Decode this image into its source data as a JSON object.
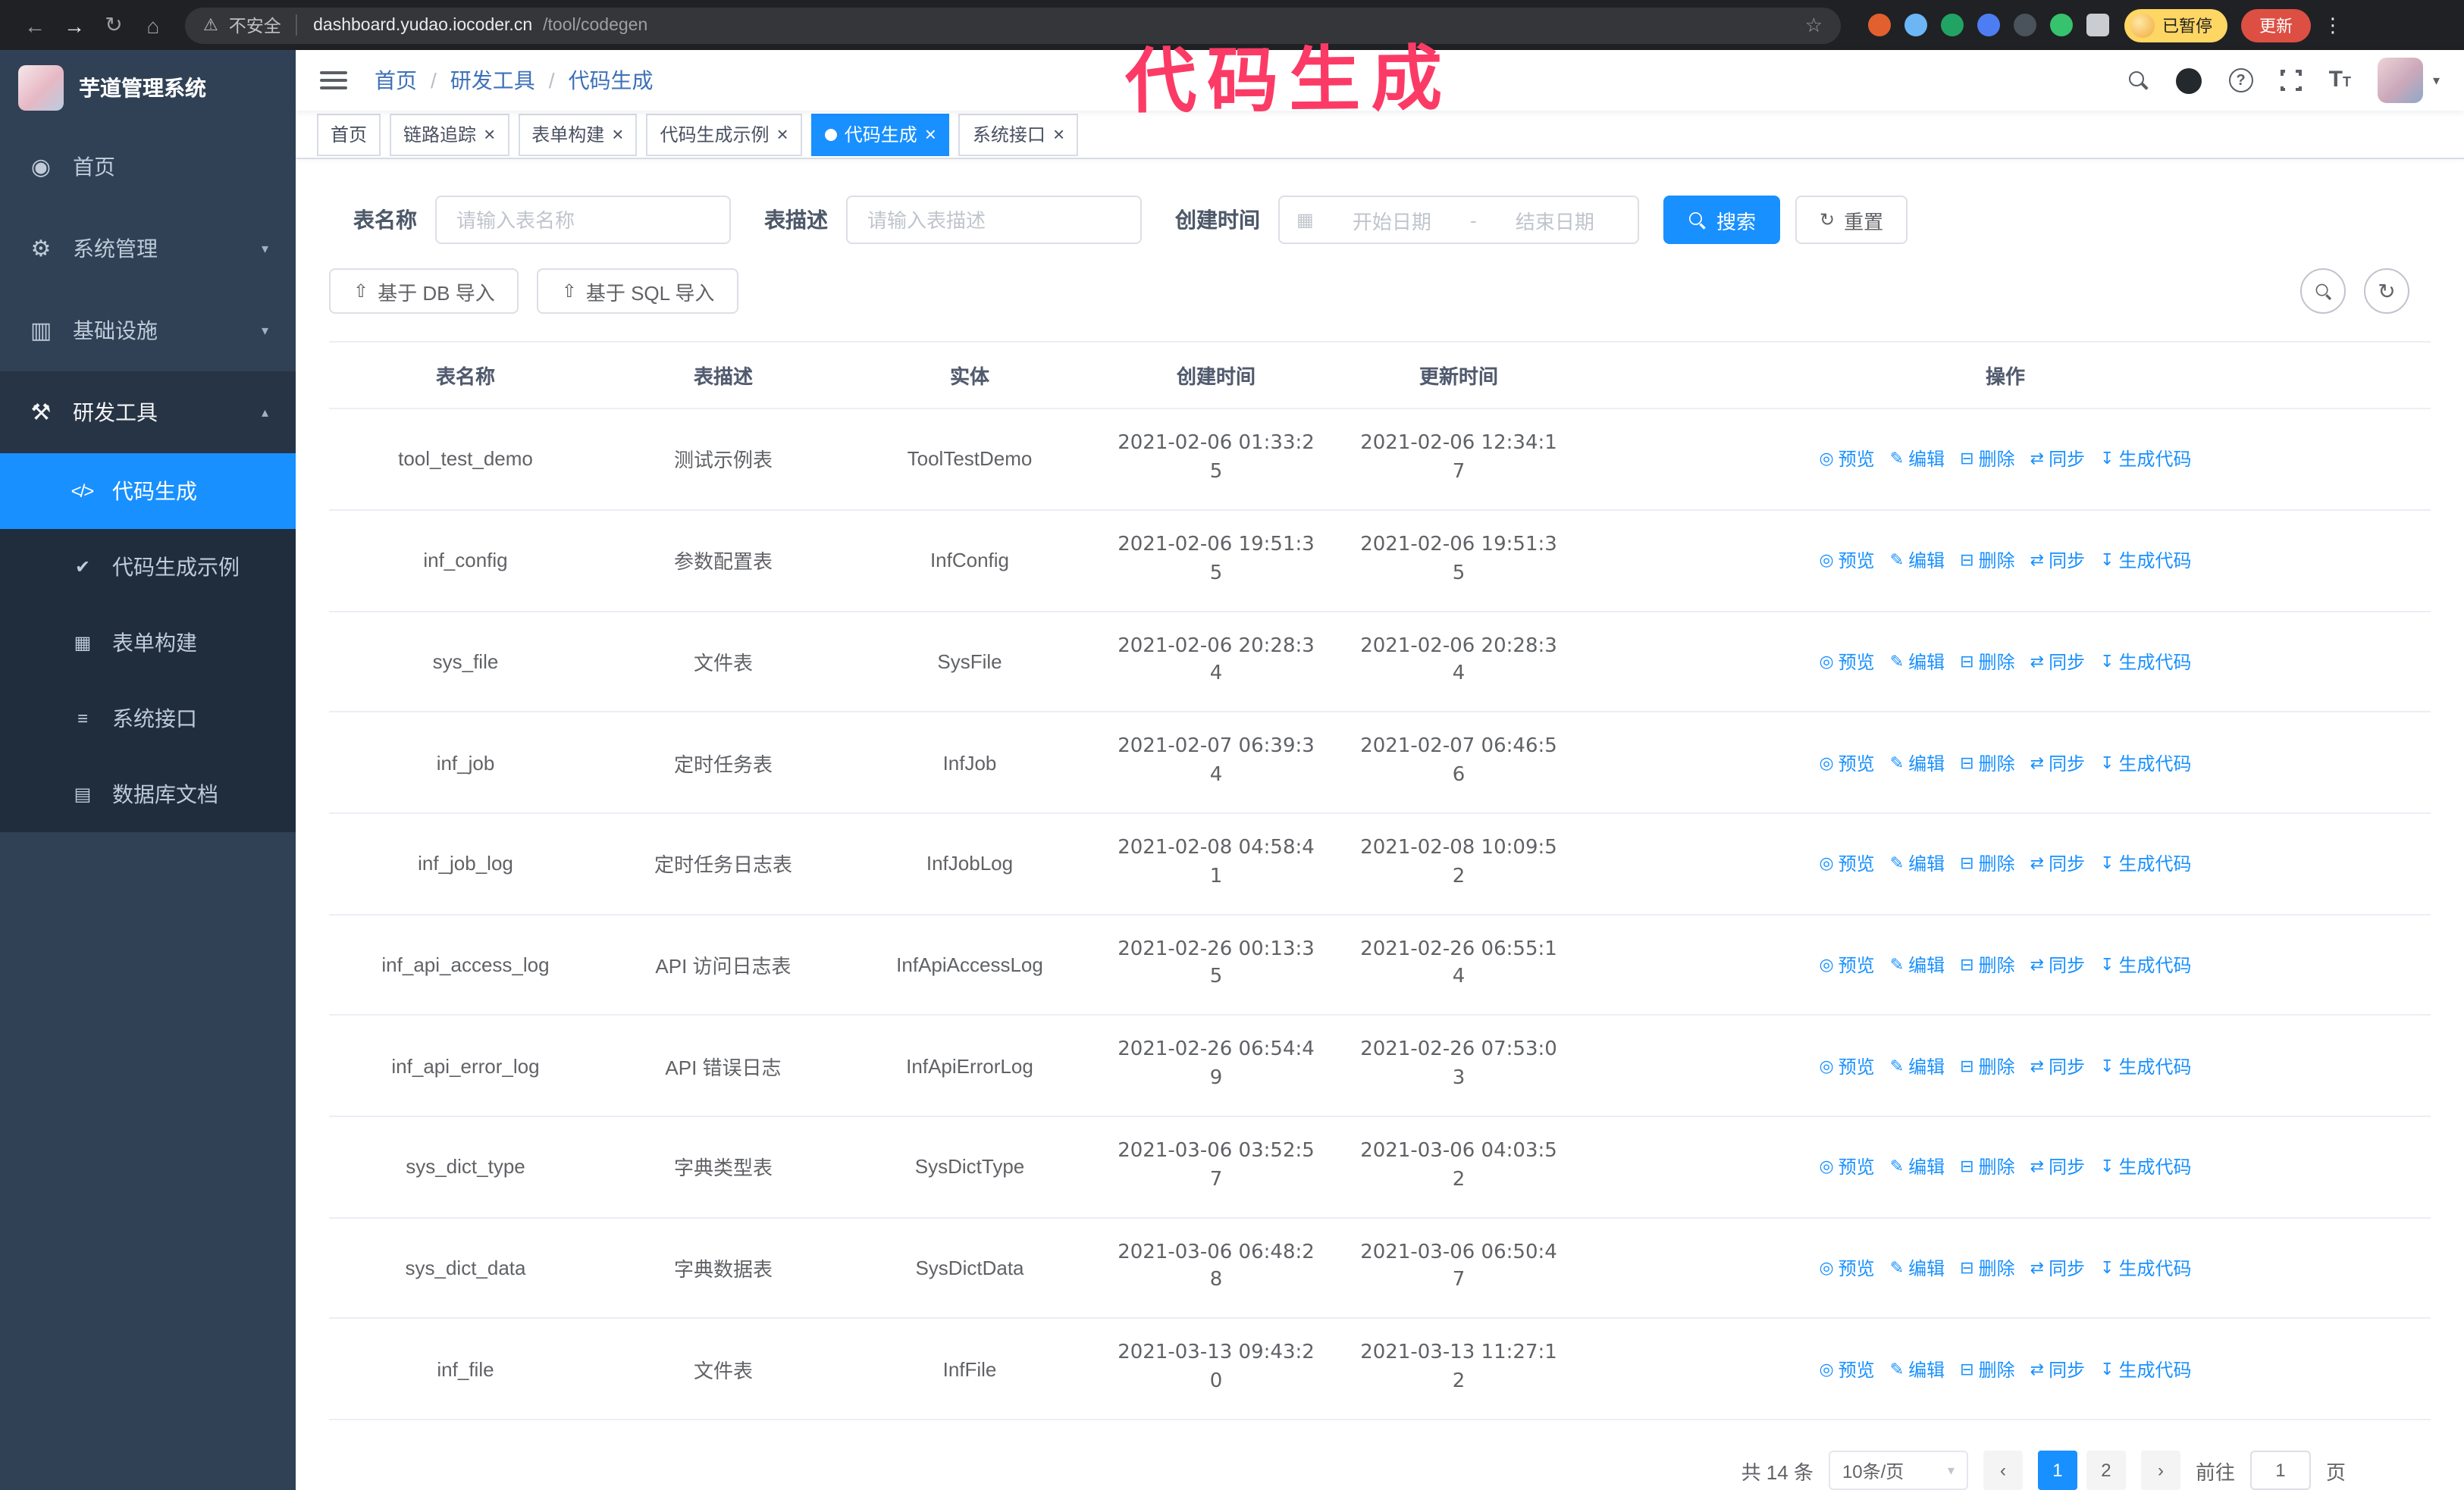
{
  "browser": {
    "security_label": "不安全",
    "url_domain": "dashboard.yudao.iocoder.cn",
    "url_path": "/tool/codegen",
    "profile_badge": "已暂停",
    "update_button": "更新",
    "extensions": [
      {
        "name": "extension-icon-orange",
        "color": "#e2602f"
      },
      {
        "name": "extension-icon-lightblue",
        "color": "#6cb6f5"
      },
      {
        "name": "extension-icon-green",
        "color": "#21a463"
      },
      {
        "name": "extension-icon-blue",
        "color": "#4d7df2"
      },
      {
        "name": "extension-icon-gray",
        "color": "#4a525c"
      },
      {
        "name": "extension-icon-brightgreen",
        "color": "#37c26e"
      },
      {
        "name": "puzzle-extensions-icon",
        "color": "#c9cdd2",
        "shape": "square"
      }
    ]
  },
  "annotation": "代码生成",
  "icons": {
    "back": "←",
    "forward": "→",
    "reload": "↻",
    "home": "⌂",
    "warning": "⚠",
    "pipe": "│",
    "star": "☆",
    "kebab": "⋮",
    "caret-down": "▾",
    "caret-up": "▴",
    "close": "×",
    "question": "?",
    "font-big": "T",
    "font-small": "T",
    "calendar": "▦",
    "refresh": "↻",
    "upload": "⇧",
    "prev": "‹",
    "next": "›",
    "dashboard": "◉",
    "gear": "⚙",
    "infra": "▥",
    "tools": "⚒",
    "code": "</>",
    "example": "✔",
    "form": "▦",
    "api": "≡",
    "dbdoc": "▤",
    "eye": "◎",
    "edit": "✎",
    "trash": "⊟",
    "sync": "⇄",
    "download": "↧"
  },
  "sidebar": {
    "logo_title": "芋道管理系统",
    "items": [
      {
        "label": "首页",
        "icon": "dashboard",
        "icon_name": "dashboard-icon"
      },
      {
        "label": "系统管理",
        "icon": "gear",
        "icon_name": "gear-icon",
        "arrow": "down"
      },
      {
        "label": "基础设施",
        "icon": "infra",
        "icon_name": "infrastructure-icon",
        "arrow": "down"
      },
      {
        "label": "研发工具",
        "icon": "tools",
        "icon_name": "tools-icon",
        "arrow": "up",
        "expanded": true,
        "children": [
          {
            "label": "代码生成",
            "icon": "code",
            "icon_name": "code-icon",
            "active": true
          },
          {
            "label": "代码生成示例",
            "icon": "example",
            "icon_name": "code-example-icon"
          },
          {
            "label": "表单构建",
            "icon": "form",
            "icon_name": "form-builder-icon"
          },
          {
            "label": "系统接口",
            "icon": "api",
            "icon_name": "api-icon"
          },
          {
            "label": "数据库文档",
            "icon": "dbdoc",
            "icon_name": "database-doc-icon"
          }
        ]
      }
    ]
  },
  "breadcrumb": [
    "首页",
    "研发工具",
    "代码生成"
  ],
  "tabs": [
    {
      "label": "首页",
      "closable": false,
      "active": false
    },
    {
      "label": "链路追踪",
      "closable": true,
      "active": false
    },
    {
      "label": "表单构建",
      "closable": true,
      "active": false
    },
    {
      "label": "代码生成示例",
      "closable": true,
      "active": false
    },
    {
      "label": "代码生成",
      "closable": true,
      "active": true
    },
    {
      "label": "系统接口",
      "closable": true,
      "active": false
    }
  ],
  "filters": {
    "table_name_label": "表名称",
    "table_name_placeholder": "请输入表名称",
    "table_desc_label": "表描述",
    "table_desc_placeholder": "请输入表描述",
    "create_time_label": "创建时间",
    "start_placeholder": "开始日期",
    "range_separator": "-",
    "end_placeholder": "结束日期",
    "search_label": "搜索",
    "reset_label": "重置"
  },
  "toolbar": {
    "import_db_label": "基于 DB 导入",
    "import_sql_label": "基于 SQL 导入"
  },
  "table": {
    "columns": [
      "表名称",
      "表描述",
      "实体",
      "创建时间",
      "更新时间",
      "操作"
    ],
    "actions": [
      {
        "label": "预览",
        "icon": "eye",
        "name": "preview-link"
      },
      {
        "label": "编辑",
        "icon": "edit",
        "name": "edit-link"
      },
      {
        "label": "删除",
        "icon": "trash",
        "name": "delete-link"
      },
      {
        "label": "同步",
        "icon": "sync",
        "name": "sync-link"
      },
      {
        "label": "生成代码",
        "icon": "download",
        "name": "generate-code-link"
      }
    ],
    "rows": [
      {
        "name": "tool_test_demo",
        "desc": "测试示例表",
        "entity": "ToolTestDemo",
        "created": "2021-02-06 01:33:25",
        "updated": "2021-02-06 12:34:17"
      },
      {
        "name": "inf_config",
        "desc": "参数配置表",
        "entity": "InfConfig",
        "created": "2021-02-06 19:51:35",
        "updated": "2021-02-06 19:51:35"
      },
      {
        "name": "sys_file",
        "desc": "文件表",
        "entity": "SysFile",
        "created": "2021-02-06 20:28:34",
        "updated": "2021-02-06 20:28:34"
      },
      {
        "name": "inf_job",
        "desc": "定时任务表",
        "entity": "InfJob",
        "created": "2021-02-07 06:39:34",
        "updated": "2021-02-07 06:46:56"
      },
      {
        "name": "inf_job_log",
        "desc": "定时任务日志表",
        "entity": "InfJobLog",
        "created": "2021-02-08 04:58:41",
        "updated": "2021-02-08 10:09:52"
      },
      {
        "name": "inf_api_access_log",
        "desc": "API 访问日志表",
        "entity": "InfApiAccessLog",
        "created": "2021-02-26 00:13:35",
        "updated": "2021-02-26 06:55:14"
      },
      {
        "name": "inf_api_error_log",
        "desc": "API 错误日志",
        "entity": "InfApiErrorLog",
        "created": "2021-02-26 06:54:49",
        "updated": "2021-02-26 07:53:03"
      },
      {
        "name": "sys_dict_type",
        "desc": "字典类型表",
        "entity": "SysDictType",
        "created": "2021-03-06 03:52:57",
        "updated": "2021-03-06 04:03:52"
      },
      {
        "name": "sys_dict_data",
        "desc": "字典数据表",
        "entity": "SysDictData",
        "created": "2021-03-06 06:48:28",
        "updated": "2021-03-06 06:50:47"
      },
      {
        "name": "inf_file",
        "desc": "文件表",
        "entity": "InfFile",
        "created": "2021-03-13 09:43:20",
        "updated": "2021-03-13 11:27:12"
      }
    ]
  },
  "pagination": {
    "total": "共 14 条",
    "page_size": "10条/页",
    "pages": [
      "1",
      "2"
    ],
    "active": "1",
    "goto": "前往",
    "goto_value": "1",
    "unit": "页"
  }
}
